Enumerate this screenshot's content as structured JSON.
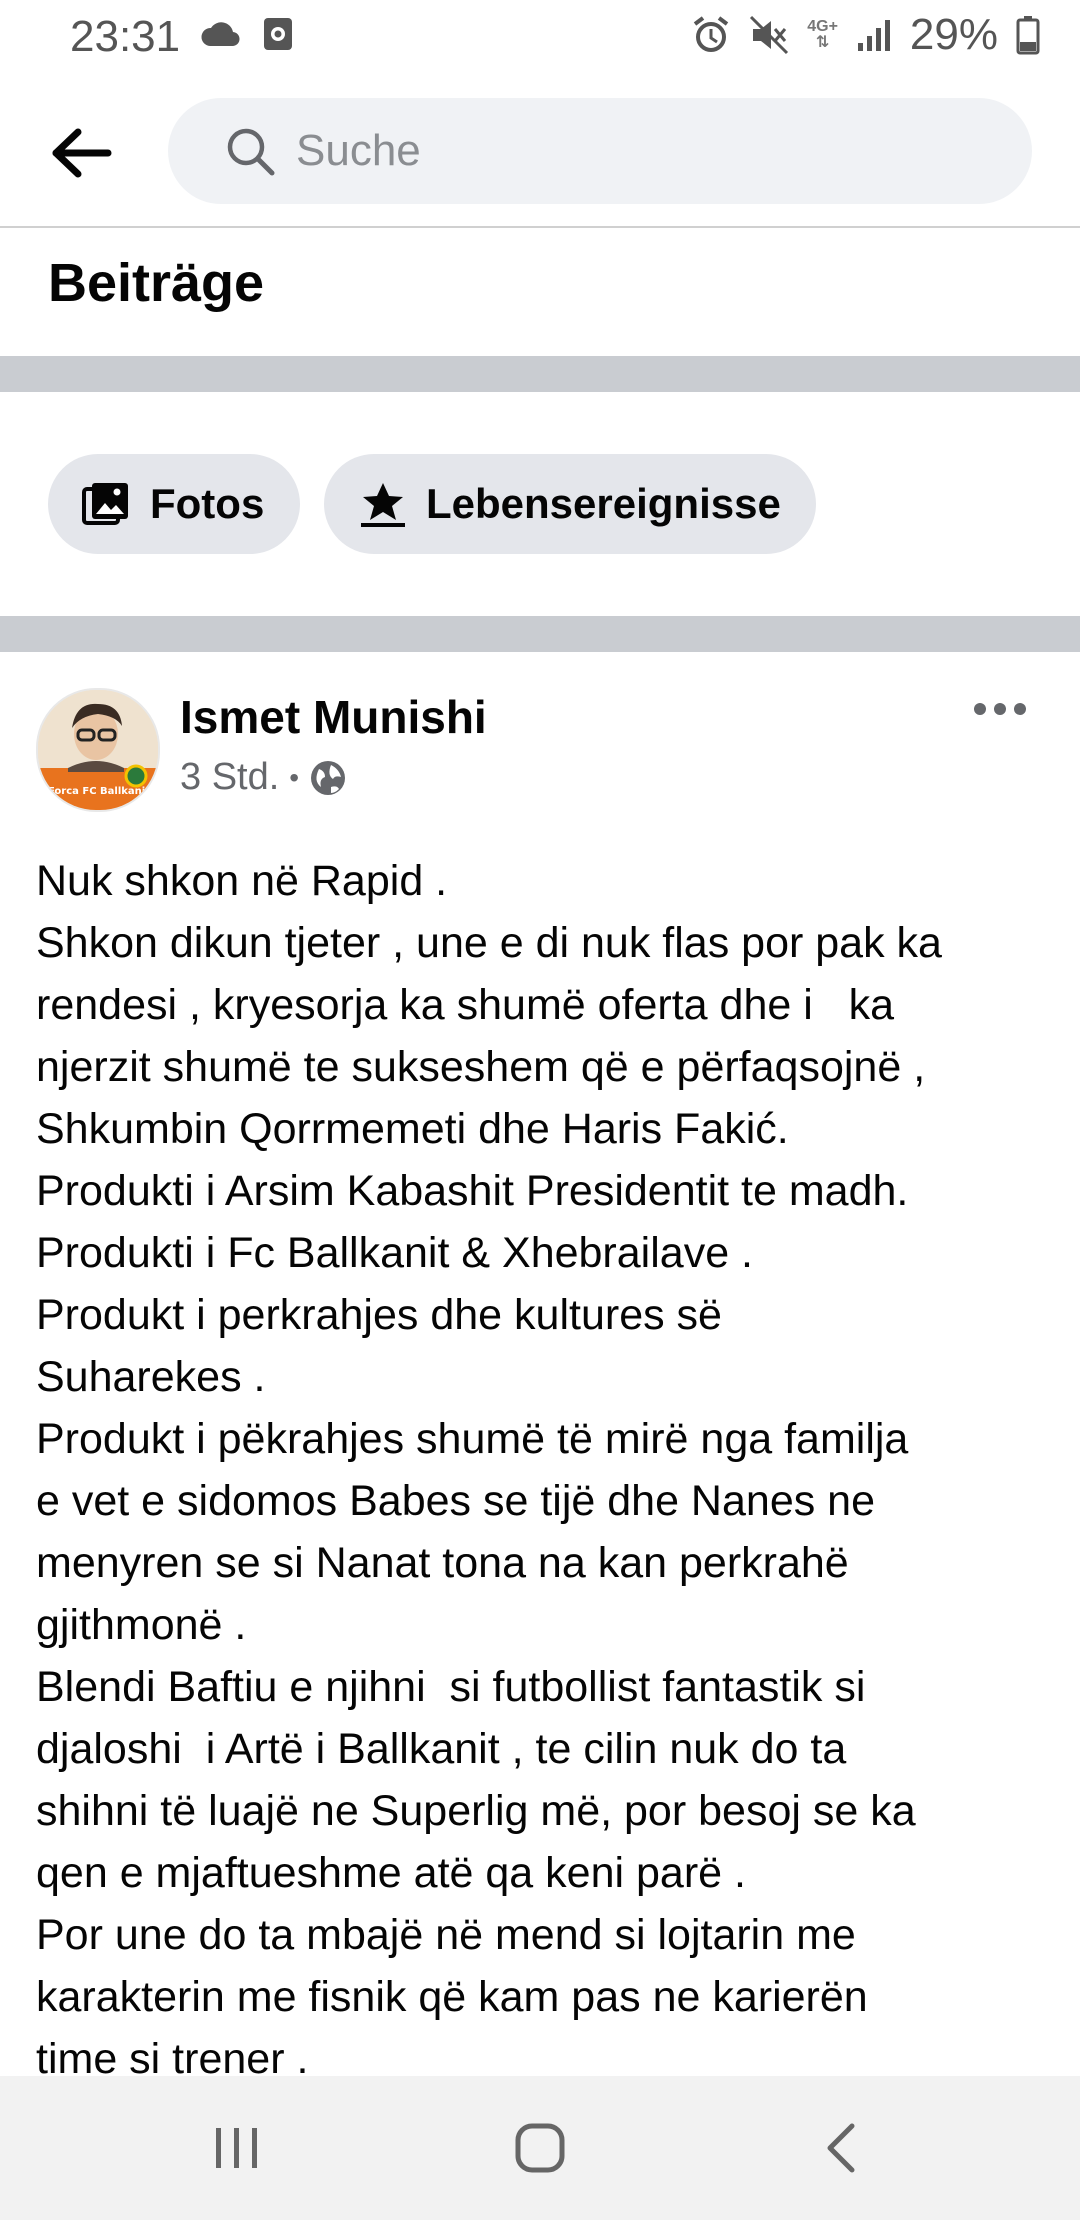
{
  "status_bar": {
    "time": "23:31",
    "left_icons": [
      "cloud-icon",
      "screen-record-icon"
    ],
    "right_icons": [
      "alarm-icon",
      "mute-icon",
      "4g-icon",
      "signal-icon",
      "battery-icon"
    ],
    "network_label": "4G+",
    "battery": "29%"
  },
  "header": {
    "search_placeholder": "Suche"
  },
  "section": {
    "title": "Beiträge"
  },
  "filters": [
    {
      "label": "Fotos",
      "icon": "photos-icon"
    },
    {
      "label": "Lebensereignisse",
      "icon": "life-event-icon"
    }
  ],
  "post": {
    "author": "Ismet Munishi",
    "time": "3 Std.",
    "separator": "•",
    "privacy_icon": "globe-icon",
    "avatar_caption": "Forca FC Ballkani",
    "lines": [
      "Nuk shkon në Rapid .",
      "Shkon dikun tjeter , une e di nuk flas por pak ka",
      "rendesi , kryesorja ka shumë oferta dhe i   ka",
      "njerzit shumë te sukseshem që e përfaqsojnë ,",
      "Shkumbin Qorrmemeti dhe Haris Fakić.",
      "Produkti i Arsim Kabashit Presidentit te madh.",
      "Produkti i Fc Ballkanit & Xhebrailave .",
      "Produkt i perkrahjes dhe kultures së",
      "Suharekes .",
      "Produkt i pëkrahjes shumë të mirë nga familja",
      "e vet e sidomos Babes se tijë dhe Nanes ne",
      "menyren se si Nanat tona na kan perkrahë",
      "gjithmonë .",
      "Blendi Baftiu e njihni  si futbollist fantastik si",
      "djaloshi  i Artë i Ballkanit , te cilin nuk do ta",
      "shihni të luajë ne Superlig më, por besoj se ka",
      "qen e mjaftueshme atë qa keni parë .",
      "Por une do ta mbajë në mend si lojtarin me",
      "karakterin me fisnik që kam pas ne karierën",
      "time si trener ."
    ]
  },
  "nav": [
    "recent-apps-button",
    "home-button",
    "back-button"
  ]
}
